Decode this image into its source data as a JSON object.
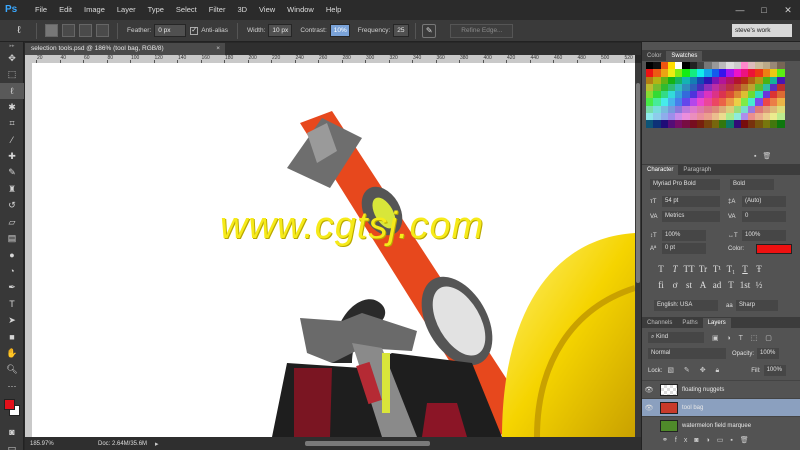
{
  "app": {
    "logo": "Ps"
  },
  "menu": [
    "File",
    "Edit",
    "Image",
    "Layer",
    "Type",
    "Select",
    "Filter",
    "3D",
    "View",
    "Window",
    "Help"
  ],
  "window_controls": {
    "minimize": "—",
    "maximize": "□",
    "close": "✕"
  },
  "options": {
    "feather_label": "Feather:",
    "feather_value": "0 px",
    "antialias_label": "Anti-alias",
    "width_label": "Width:",
    "width_value": "10 px",
    "contrast_label": "Contrast:",
    "contrast_value": "10%",
    "frequency_label": "Frequency:",
    "frequency_value": "25",
    "refine_label": "Refine Edge...",
    "workspace": "steve's work"
  },
  "document": {
    "tab_label": "selection tools.psd @ 186% (tool bag, RGB/8)",
    "ruler_ticks": [
      "20",
      "40",
      "60",
      "80",
      "100",
      "120",
      "140",
      "160",
      "180",
      "200",
      "220",
      "240",
      "260",
      "280",
      "300",
      "320",
      "340",
      "360",
      "380",
      "400",
      "420",
      "440",
      "460",
      "480",
      "500",
      "520"
    ],
    "zoom": "185.97%",
    "doc_info": "Doc: 2.64M/35.6M"
  },
  "watermark": "www.cgtsj.com",
  "tools": [
    "move-tool",
    "marquee-tool",
    "lasso-tool",
    "quick-select-tool",
    "crop-tool",
    "eyedropper-tool",
    "healing-tool",
    "brush-tool",
    "stamp-tool",
    "history-brush-tool",
    "eraser-tool",
    "gradient-tool",
    "blur-tool",
    "dodge-tool",
    "pen-tool",
    "type-tool",
    "path-select-tool",
    "shape-tool",
    "hand-tool",
    "zoom-tool",
    "more-tool"
  ],
  "colors": {
    "foreground": "#e3101a",
    "background": "#ffffff",
    "accent": "#7aa3d9"
  },
  "panels": {
    "color_tabs": [
      "Color",
      "Swatches"
    ],
    "character_tabs": [
      "Character",
      "Paragraph"
    ],
    "font_family": "Myriad Pro Bold",
    "font_style": "Bold",
    "font_size": "54 pt",
    "leading": "(Auto)",
    "kerning": "Metrics",
    "tracking": "0",
    "vscale": "100%",
    "hscale": "100%",
    "baseline": "0 pt",
    "color_label": "Color:",
    "type_buttons": [
      "T",
      "T",
      "TT",
      "Tr",
      "T¹",
      "T₁",
      "T",
      "Ŧ"
    ],
    "ot_buttons": [
      "fi",
      "ơ",
      "st",
      "A",
      "ad",
      "T",
      "1st",
      "½"
    ],
    "language": "English: USA",
    "antialias": "Sharp",
    "aa_prefix": "aa",
    "layers_tabs": [
      "Channels",
      "Paths",
      "Layers"
    ],
    "kind_label": "Kind",
    "blend_mode": "Normal",
    "opacity_label": "Opacity:",
    "opacity": "100%",
    "lock_label": "Lock:",
    "fill_label": "Fill:",
    "fill": "100%",
    "layers": [
      "floating nuggets",
      "tool bag",
      "watermelon field marquee"
    ]
  }
}
